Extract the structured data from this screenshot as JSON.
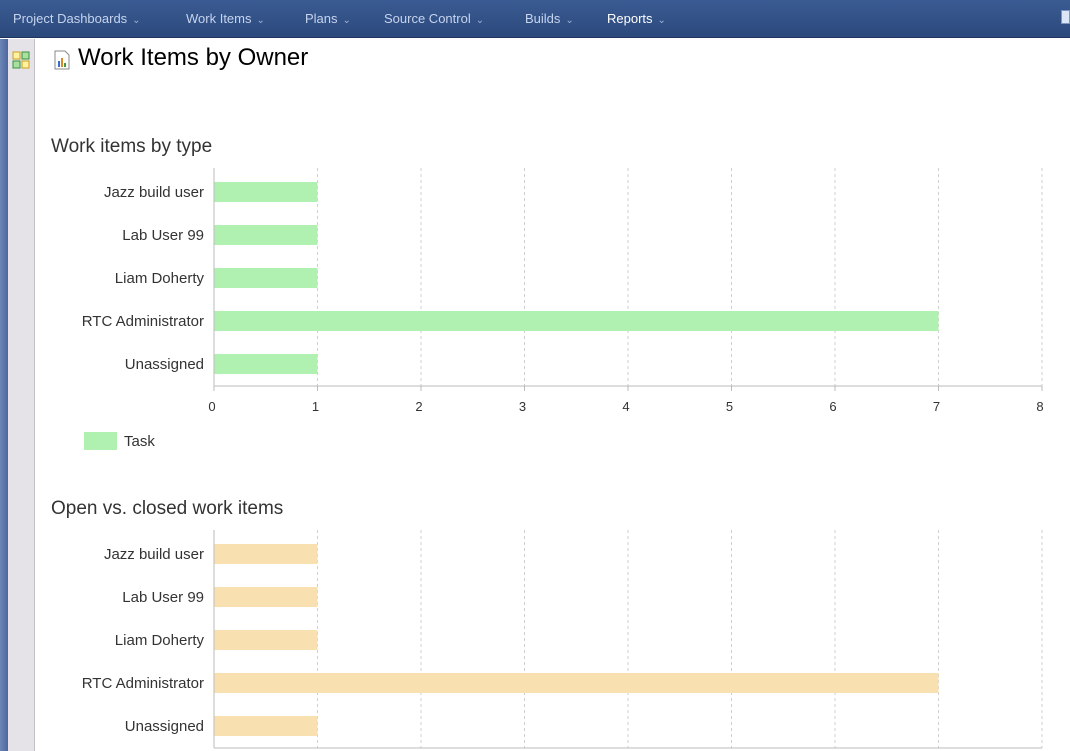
{
  "nav": {
    "items": [
      {
        "label": "Project Dashboards"
      },
      {
        "label": "Work Items"
      },
      {
        "label": "Plans"
      },
      {
        "label": "Source Control"
      },
      {
        "label": "Builds"
      },
      {
        "label": "Reports"
      }
    ],
    "active_item": "Reports",
    "caret_icon": "chevron-down-icon"
  },
  "page": {
    "title": "Work Items by Owner",
    "title_icon": "report-icon"
  },
  "colors": {
    "nav_bar": "#2e4b7f",
    "task_bar": "#b0f0b0",
    "open_closed_bar": "#f8e0b0"
  },
  "chart_data": [
    {
      "type": "bar",
      "orientation": "horizontal",
      "title": "Work items by type",
      "categories": [
        "Jazz build user",
        "Lab User 99",
        "Liam Doherty",
        "RTC Administrator",
        "Unassigned"
      ],
      "series": [
        {
          "name": "Task",
          "values": [
            1,
            1,
            1,
            7,
            1
          ],
          "color": "#b0f0b0"
        }
      ],
      "xlim": [
        0,
        8
      ],
      "xticks": [
        0,
        1,
        2,
        3,
        4,
        5,
        6,
        7,
        8
      ],
      "grid": "vertical dashed",
      "legend": "bottom-left"
    },
    {
      "type": "bar",
      "orientation": "horizontal",
      "title": "Open vs. closed work items",
      "categories": [
        "Jazz build user",
        "Lab User 99",
        "Liam Doherty",
        "RTC Administrator",
        "Unassigned"
      ],
      "series": [
        {
          "values": [
            1,
            1,
            1,
            7,
            1
          ],
          "color": "#f8e0b0"
        }
      ],
      "xlim": [
        0,
        8
      ],
      "grid": "vertical dashed"
    }
  ]
}
